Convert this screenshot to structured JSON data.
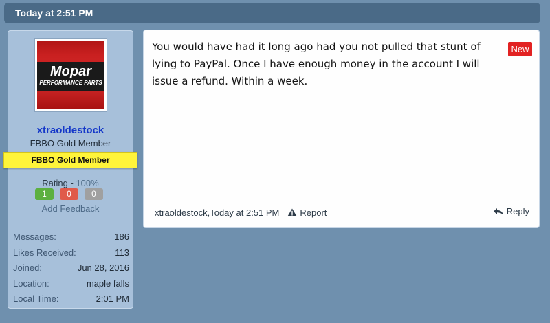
{
  "date_bar": {
    "text": "Today at 2:51 PM"
  },
  "user": {
    "avatar_brand": "Mopar",
    "avatar_tagline": "PERFORMANCE PARTS",
    "username": "xtraoldestock",
    "title": "FBBO Gold Member",
    "banner": "FBBO Gold Member",
    "rating_label": "Rating - ",
    "rating_pct": "100%",
    "rating_positive": "1",
    "rating_negative": "0",
    "rating_neutral": "0",
    "add_feedback": "Add Feedback",
    "stats": [
      {
        "label": "Messages:",
        "value": "186"
      },
      {
        "label": "Likes Received:",
        "value": "113"
      },
      {
        "label": "Joined:",
        "value": "Jun 28, 2016"
      },
      {
        "label": "Location:",
        "value": "maple falls"
      },
      {
        "label": "Local Time:",
        "value": "2:01 PM"
      }
    ]
  },
  "post": {
    "text": "You would have had it long ago had you not pulled that stunt of lying to PayPal. Once I have enough money in the account I will issue a refund. Within a week.",
    "badge": "New",
    "author": "xtraoldestock",
    "comma": ", ",
    "time": "Today at 2:51 PM",
    "report_label": "Report",
    "reply_label": "Reply"
  },
  "colors": {
    "background": "#6f90ae",
    "date_bar": "#4a6a87",
    "username": "#1538c9",
    "gold_banner": "#fff43a",
    "new_badge": "#e22222",
    "positive": "#5cb040",
    "negative": "#e05a4a",
    "neutral": "#a0a0a0"
  },
  "icons": {
    "report": "warning-triangle-icon",
    "reply": "reply-arrow-icon"
  }
}
